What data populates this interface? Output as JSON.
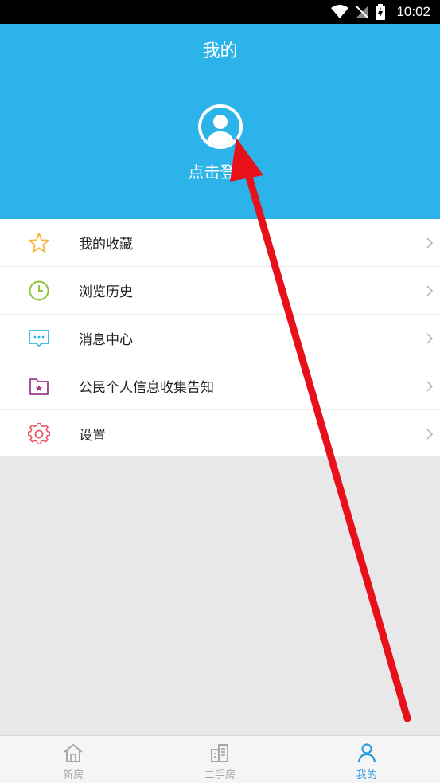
{
  "status_bar": {
    "time": "10:02"
  },
  "header": {
    "title": "我的",
    "login_text": "点击登录",
    "bg_color": "#2bb3ea"
  },
  "menu": {
    "items": [
      {
        "label": "我的收藏",
        "icon": "star-icon",
        "icon_color": "#f5b43c"
      },
      {
        "label": "浏览历史",
        "icon": "clock-icon",
        "icon_color": "#8cc63f"
      },
      {
        "label": "消息中心",
        "icon": "message-icon",
        "icon_color": "#2bb3ea"
      },
      {
        "label": "公民个人信息收集告知",
        "icon": "folder-star-icon",
        "icon_color": "#9b3e8e"
      },
      {
        "label": "设置",
        "icon": "gear-icon",
        "icon_color": "#e8525f"
      }
    ]
  },
  "bottom_nav": {
    "items": [
      {
        "label": "新房",
        "icon": "home-icon",
        "active": false
      },
      {
        "label": "二手房",
        "icon": "building-icon",
        "active": false
      },
      {
        "label": "我的",
        "icon": "user-icon",
        "active": true
      }
    ],
    "active_color": "#2b9be0"
  },
  "annotation": {
    "type": "arrow",
    "color": "#e8111b",
    "points_to": "avatar"
  }
}
